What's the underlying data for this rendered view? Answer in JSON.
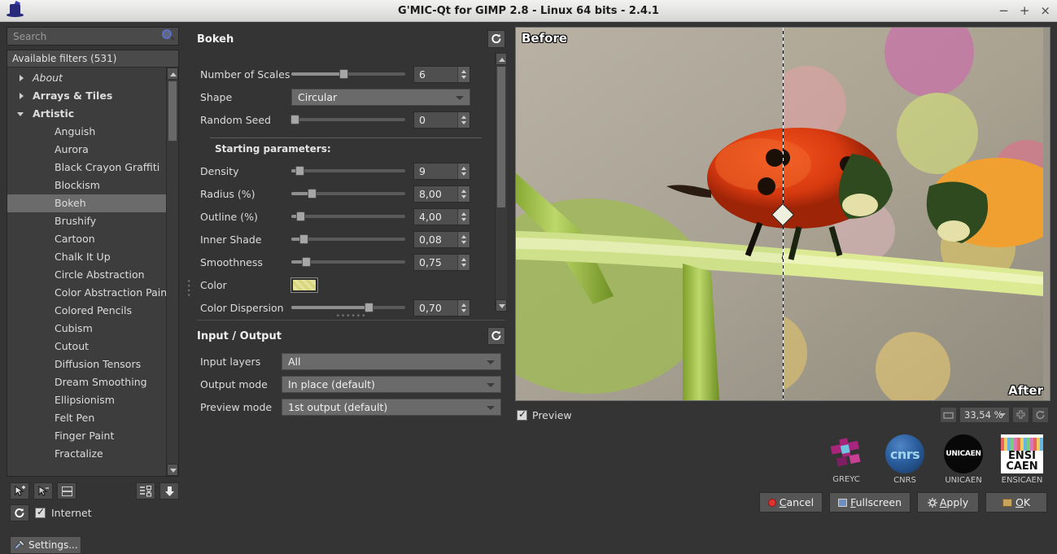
{
  "window": {
    "title": "G'MIC-Qt for GIMP 2.8 - Linux 64 bits - 2.4.1",
    "icon": "gmic-hat-icon",
    "minimize": "−",
    "maximize": "+",
    "close": "×"
  },
  "sidebar": {
    "search": {
      "placeholder": "Search",
      "value": "",
      "icon": "search-icon"
    },
    "filters_header": "Available filters (531)",
    "tree": [
      {
        "label": "About",
        "type": "category",
        "style": "italic",
        "expanded": false
      },
      {
        "label": "Arrays & Tiles",
        "type": "category",
        "style": "bold",
        "expanded": false
      },
      {
        "label": "Artistic",
        "type": "category",
        "style": "bold",
        "expanded": true
      },
      {
        "label": "Anguish",
        "type": "leaf",
        "selected": false
      },
      {
        "label": "Aurora",
        "type": "leaf",
        "selected": false
      },
      {
        "label": "Black Crayon Graffiti",
        "type": "leaf",
        "selected": false
      },
      {
        "label": "Blockism",
        "type": "leaf",
        "selected": false
      },
      {
        "label": "Bokeh",
        "type": "leaf",
        "selected": true
      },
      {
        "label": "Brushify",
        "type": "leaf",
        "selected": false
      },
      {
        "label": "Cartoon",
        "type": "leaf",
        "selected": false
      },
      {
        "label": "Chalk It Up",
        "type": "leaf",
        "selected": false
      },
      {
        "label": "Circle Abstraction",
        "type": "leaf",
        "selected": false
      },
      {
        "label": "Color Abstraction Paint",
        "type": "leaf",
        "selected": false
      },
      {
        "label": "Colored Pencils",
        "type": "leaf",
        "selected": false
      },
      {
        "label": "Cubism",
        "type": "leaf",
        "selected": false
      },
      {
        "label": "Cutout",
        "type": "leaf",
        "selected": false
      },
      {
        "label": "Diffusion Tensors",
        "type": "leaf",
        "selected": false
      },
      {
        "label": "Dream Smoothing",
        "type": "leaf",
        "selected": false
      },
      {
        "label": "Ellipsionism",
        "type": "leaf",
        "selected": false
      },
      {
        "label": "Felt Pen",
        "type": "leaf",
        "selected": false
      },
      {
        "label": "Finger Paint",
        "type": "leaf",
        "selected": false
      },
      {
        "label": "Fractalize",
        "type": "leaf",
        "selected": false
      }
    ],
    "tools": [
      {
        "name": "add-favorite-button",
        "icon": "cursor-plus-icon"
      },
      {
        "name": "remove-favorite-button",
        "icon": "cursor-minus-icon"
      },
      {
        "name": "rename-filter-button",
        "icon": "abc-rename-icon"
      },
      {
        "name": "expand-collapse-button",
        "icon": "list-expand-icon"
      },
      {
        "name": "download-button",
        "icon": "arrow-down-icon"
      }
    ],
    "refresh_label": "refresh-filters-icon",
    "internet": {
      "label": "Internet",
      "checked": true
    },
    "settings_label": "Settings..."
  },
  "params": {
    "title": "Bokeh",
    "refresh_icon": "reset-icon",
    "section_label": "Starting parameters:",
    "rows": [
      {
        "label": "Number of Scales",
        "type": "slider",
        "value": "6",
        "pos": 46
      },
      {
        "label": "Shape",
        "type": "combo",
        "value": "Circular"
      },
      {
        "label": "Random Seed",
        "type": "slider",
        "value": "0",
        "pos": 3
      },
      {
        "label": "Density",
        "type": "slider",
        "value": "9",
        "pos": 7
      },
      {
        "label": "Radius (%)",
        "type": "slider",
        "value": "8,00",
        "pos": 18
      },
      {
        "label": "Outline (%)",
        "type": "slider",
        "value": "4,00",
        "pos": 8
      },
      {
        "label": "Inner Shade",
        "type": "slider",
        "value": "0,08",
        "pos": 11
      },
      {
        "label": "Smoothness",
        "type": "slider",
        "value": "0,75",
        "pos": 13
      },
      {
        "label": "Color",
        "type": "color",
        "value": "#d9d77a"
      },
      {
        "label": "Color Dispersion",
        "type": "slider",
        "value": "0,70",
        "pos": 68
      }
    ]
  },
  "io": {
    "title": "Input / Output",
    "refresh_icon": "reset-icon",
    "rows": [
      {
        "label": "Input layers",
        "value": "All"
      },
      {
        "label": "Output mode",
        "value": "In place (default)"
      },
      {
        "label": "Preview mode",
        "value": "1st output (default)"
      }
    ]
  },
  "preview": {
    "before_label": "Before",
    "after_label": "After",
    "checkbox": {
      "label": "Preview",
      "checked": true
    },
    "zoom": {
      "value": "33,54 %"
    },
    "zoom_buttons": [
      {
        "name": "zoom-fit-button",
        "icon": "fit-icon"
      },
      {
        "name": "zoom-in-button",
        "icon": "plus-icon"
      },
      {
        "name": "zoom-reset-button",
        "icon": "reset-icon"
      }
    ]
  },
  "logos": [
    {
      "caption": "GREYC",
      "name": "greyc-logo"
    },
    {
      "caption": "CNRS",
      "name": "cnrs-logo",
      "text": "cnrs"
    },
    {
      "caption": "UNICAEN",
      "name": "unicaen-logo",
      "text": "UNICAEN"
    },
    {
      "caption": "ENSICAEN",
      "name": "ensicaen-logo",
      "line1": "ENSI",
      "line2": "CAEN"
    }
  ],
  "actions": [
    {
      "label": "Cancel",
      "accel": "C",
      "icon": "red-circle-icon"
    },
    {
      "label": "Fullscreen",
      "accel": "F",
      "icon": "fullscreen-icon"
    },
    {
      "label": "Apply",
      "accel": "A",
      "icon": "gear-icon"
    },
    {
      "label": "OK",
      "accel": "O",
      "icon": "screen-icon"
    }
  ]
}
